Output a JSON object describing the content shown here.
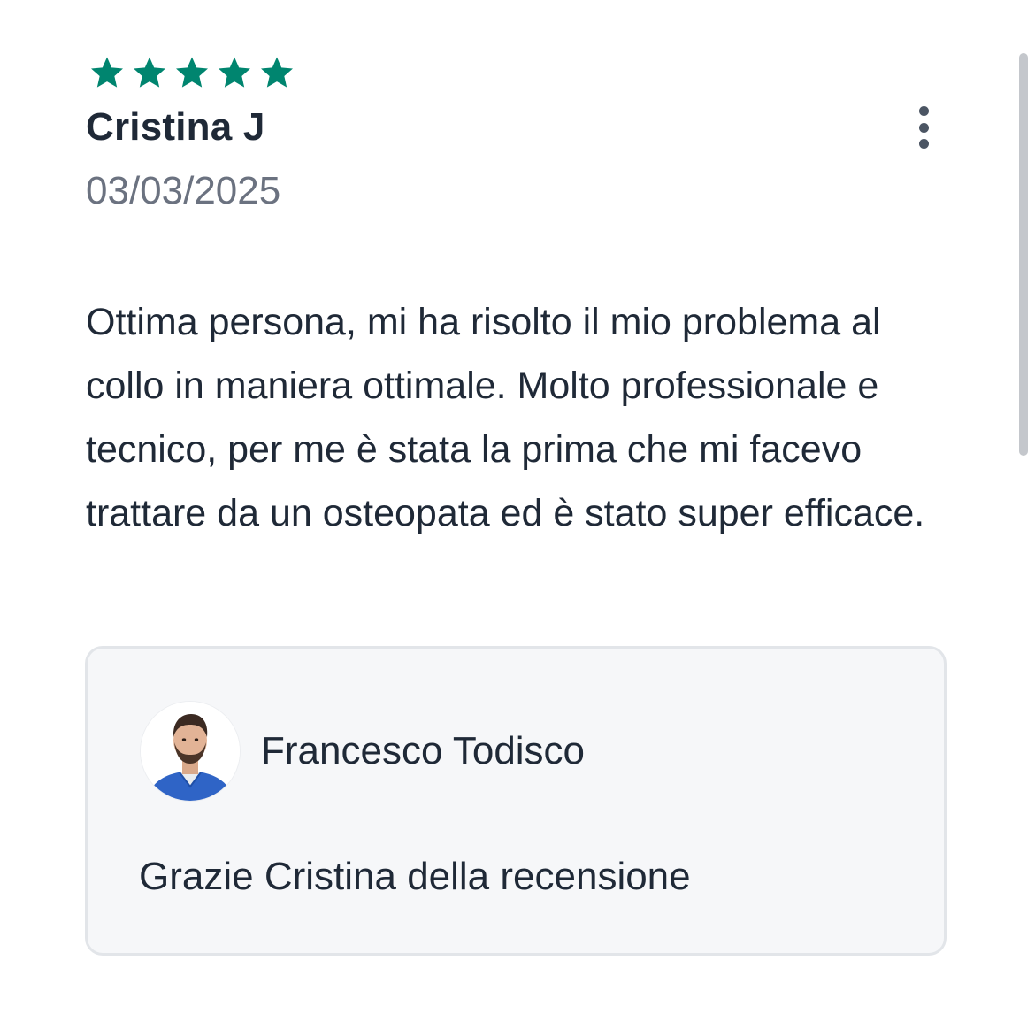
{
  "review": {
    "rating": 5,
    "rating_max": 5,
    "star_color": "#00856f",
    "author": "Cristina J",
    "date": "03/03/2025",
    "text": "Ottima persona, mi ha risolto il mio problema al collo in maniera ottimale. Molto professionale e tecnico, per me è stata la prima che mi facevo trattare da un osteopata ed è stato super efficace."
  },
  "menu": {
    "icon": "more-vertical-icon"
  },
  "reply": {
    "name": "Francesco Todisco",
    "text": "Grazie Cristina della recensione",
    "avatar": "avatar-photo"
  }
}
